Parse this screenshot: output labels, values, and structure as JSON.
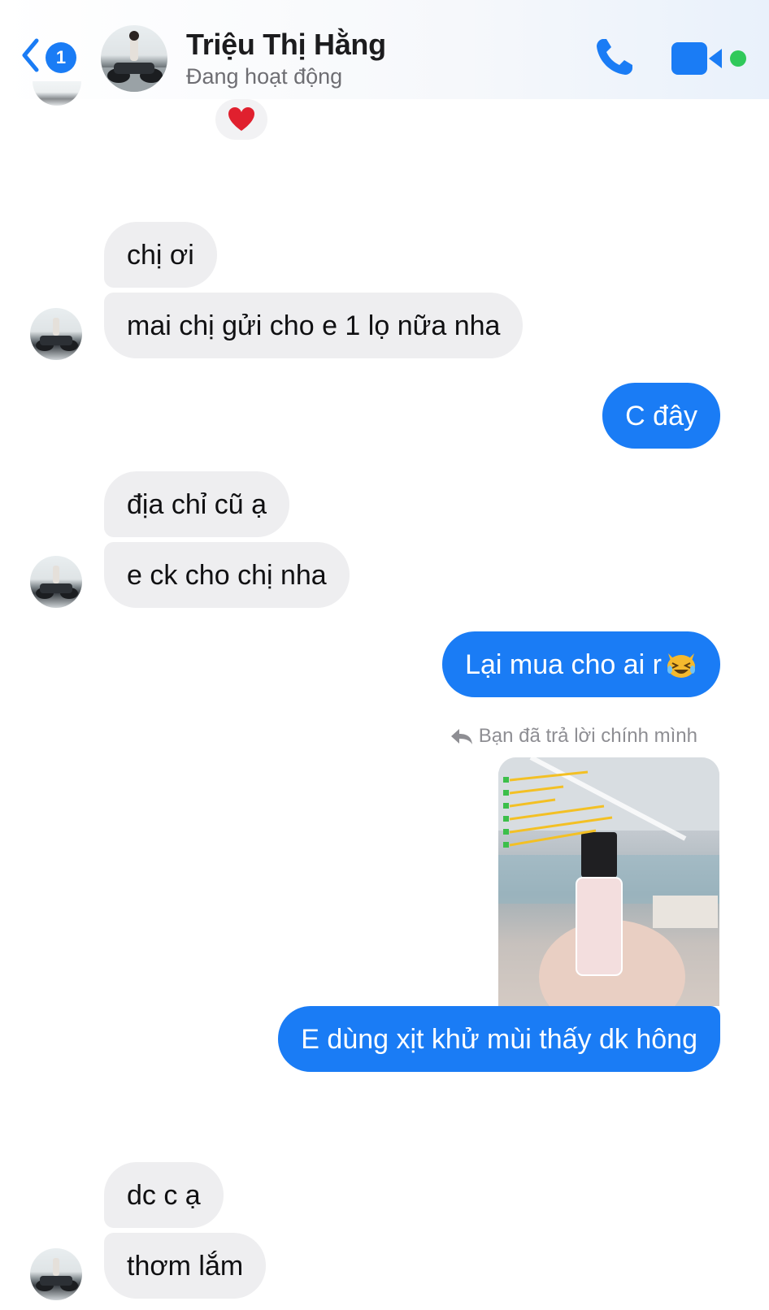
{
  "header": {
    "unread_count": "1",
    "contact_name": "Triệu Thị Hằng",
    "status": "Đang hoạt động"
  },
  "colors": {
    "accent": "#1a7cf5",
    "received_bubble": "#eeeef0",
    "online": "#30c95a",
    "heart": "#e0202e"
  },
  "icons": [
    "back-chevron-icon",
    "phone-icon",
    "video-camera-icon",
    "reply-arrow-icon",
    "heart-icon",
    "laughing-cat-emoji"
  ],
  "messages": [
    {
      "from": "contact",
      "text": "chị ơi"
    },
    {
      "from": "contact",
      "text": "mai chị gửi cho e 1 lọ nữa nha"
    },
    {
      "from": "me",
      "text": "C đây"
    },
    {
      "from": "contact",
      "text": "địa chỉ cũ ạ"
    },
    {
      "from": "contact",
      "text": "e ck cho chị nha"
    },
    {
      "from": "me",
      "text": "Lại mua cho ai r"
    },
    {
      "from": "me",
      "reply_note": "Bạn đã trả lời chính mình",
      "text": "E dùng xịt khử mùi thấy dk hông"
    },
    {
      "from": "contact",
      "text": "dc c ạ"
    },
    {
      "from": "contact",
      "text": "thơm lắm"
    }
  ]
}
